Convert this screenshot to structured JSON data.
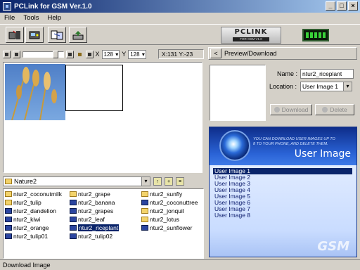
{
  "window": {
    "title": "PCLink for GSM Ver.1.0"
  },
  "menu": [
    "File",
    "Tools",
    "Help"
  ],
  "logo": {
    "main": "PCLINK",
    "sub": "FOR GSM V1.0"
  },
  "editor": {
    "x_label": "X",
    "x_value": "128",
    "y_label": "Y",
    "y_value": "128",
    "coords": "X:131 Y:-23"
  },
  "folder": {
    "name": "Nature2"
  },
  "files": [
    [
      {
        "name": "ntur2_coconutmilk",
        "type": "folder"
      },
      {
        "name": "ntur2_tulip",
        "type": "folder"
      },
      {
        "name": "ntur2_dandelion",
        "type": "file"
      },
      {
        "name": "ntur2_kiwi",
        "type": "file"
      },
      {
        "name": "ntur2_orange",
        "type": "file"
      },
      {
        "name": "ntur2_tulip01",
        "type": "file"
      }
    ],
    [
      {
        "name": "ntur2_grape",
        "type": "folder"
      },
      {
        "name": "ntur2_banana",
        "type": "file"
      },
      {
        "name": "ntur2_grapes",
        "type": "file"
      },
      {
        "name": "ntur2_leaf",
        "type": "file"
      },
      {
        "name": "ntur2_riceplant",
        "type": "file",
        "selected": true
      },
      {
        "name": "ntur2_tulip02",
        "type": "file"
      }
    ],
    [
      {
        "name": "ntur2_sunfly",
        "type": "folder"
      },
      {
        "name": "ntur2_coconuttree",
        "type": "file"
      },
      {
        "name": "ntur2_jonquil",
        "type": "folder"
      },
      {
        "name": "ntur2_lotus",
        "type": "folder"
      },
      {
        "name": "ntur2_sunflower",
        "type": "file"
      }
    ]
  ],
  "preview": {
    "header": "Preview/Download",
    "name_label": "Name :",
    "name_value": "ntur2_riceplant",
    "location_label": "Location :",
    "location_value": "User Image 1",
    "download_label": "Download",
    "delete_label": "Delete"
  },
  "user_panel": {
    "small_text_1": "YOU CAN DOWNLOAD USER IMAGES UP TO",
    "small_text_2": "8 TO YOUR PHONE, AND DELETE THEM.",
    "title": "User Image",
    "items": [
      "User Image 1",
      "User Image 2",
      "User Image 3",
      "User Image 4",
      "User Image 5",
      "User Image 6",
      "User Image 7",
      "User Image 8"
    ],
    "selected_index": 0,
    "watermark": "GSM"
  },
  "status": {
    "text": "Download Image"
  },
  "colors": {
    "title_start": "#0a246a",
    "selection": "#0a246a",
    "panel_blue": "#2a63d6"
  }
}
